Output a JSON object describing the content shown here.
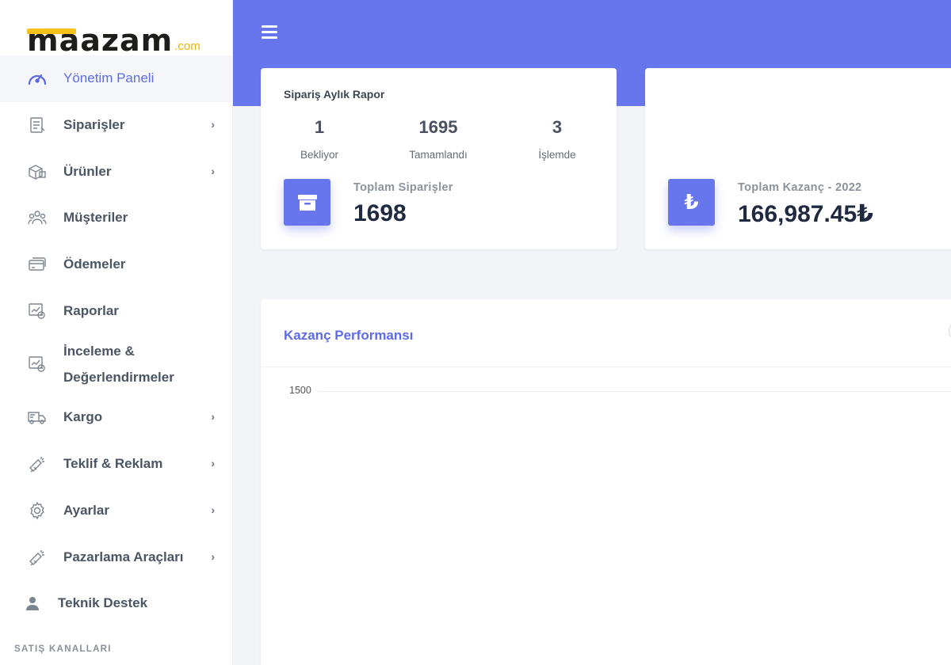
{
  "brand": {
    "name": "maazam",
    "suffix": ".com",
    "accent": "#f7c21b",
    "primary": "#6876ee"
  },
  "sidebar": {
    "items": [
      {
        "label": "Yönetim Paneli",
        "icon": "dashboard-gauge-icon",
        "active": true,
        "has_submenu": false
      },
      {
        "label": "Siparişler",
        "icon": "orders-list-icon",
        "has_submenu": true
      },
      {
        "label": "Ürünler",
        "icon": "product-box-icon",
        "has_submenu": true
      },
      {
        "label": "Müşteriler",
        "icon": "customers-group-icon",
        "has_submenu": false
      },
      {
        "label": "Ödemeler",
        "icon": "payment-card-icon",
        "has_submenu": false
      },
      {
        "label": "Raporlar",
        "icon": "reports-chart-icon",
        "has_submenu": false
      },
      {
        "label_line1": "İnceleme &",
        "label_line2": "Değerlendirmeler",
        "icon": "reviews-chart-icon",
        "has_submenu": false
      },
      {
        "label": "Kargo",
        "icon": "delivery-truck-icon",
        "has_submenu": true
      },
      {
        "label": "Teklif & Reklam",
        "icon": "megaphone-icon",
        "has_submenu": true
      },
      {
        "label": "Ayarlar",
        "icon": "gear-icon",
        "has_submenu": true
      },
      {
        "label": "Pazarlama Araçları",
        "icon": "marketing-megaphone-icon",
        "has_submenu": true
      },
      {
        "label": "Teknik Destek",
        "icon": "user-icon",
        "has_submenu": false
      }
    ],
    "section_label": "SATIŞ KANALLARI"
  },
  "orders_card": {
    "title": "Sipariş Aylık Rapor",
    "stats": [
      {
        "value": "1",
        "caption": "Bekliyor"
      },
      {
        "value": "1695",
        "caption": "Tamamlandı"
      },
      {
        "value": "3",
        "caption": "İşlemde"
      }
    ],
    "total_label": "Toplam Siparişler",
    "total_value": "1698",
    "icon": "archive-box-icon"
  },
  "earnings_card": {
    "label": "Toplam Kazanç - 2022",
    "value": "166,987.45₺",
    "icon": "lira-icon",
    "icon_glyph": "₺"
  },
  "performance": {
    "title": "Kazanç Performansı",
    "y_tick": "1500"
  }
}
